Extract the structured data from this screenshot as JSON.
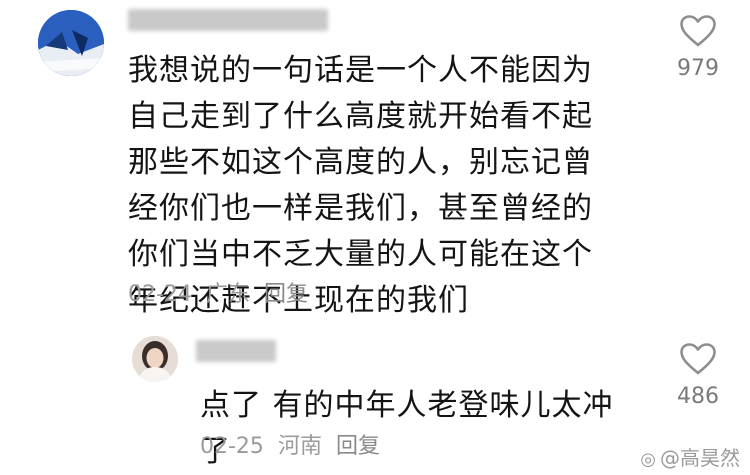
{
  "comment": {
    "text": "我想说的一句话是一个人不能因为自己走到了什么高度就开始看不起那些不如这个高度的人，别忘记曾经你们也一样是我们，甚至曾经的你们当中不乏大量的人可能在这个年纪还赶不上现在的我们",
    "date": "02-24",
    "location": "广东",
    "reply_label": "回复",
    "like_count": "979"
  },
  "reply": {
    "text": "点了 有的中年人老登味儿太冲了",
    "date": "02-25",
    "location": "河南",
    "reply_label": "回复",
    "like_count": "486"
  },
  "watermark": {
    "text": "@高昊然"
  },
  "icons": {
    "like": "heart-outline-icon",
    "watermark": "weibo-icon"
  }
}
